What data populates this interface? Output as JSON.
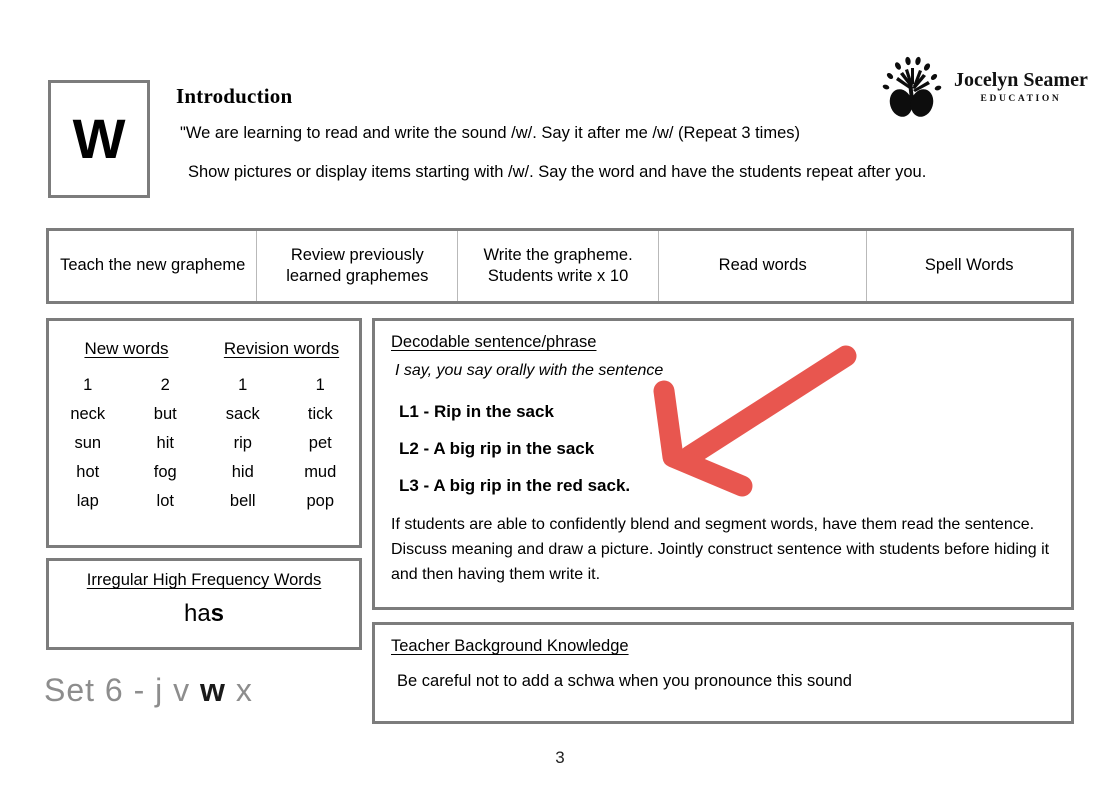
{
  "header": {
    "grapheme_letter": "W",
    "intro_title": "Introduction",
    "intro_line_1": "\"We are learning to read and write the sound /w/.  Say it after me /w/ (Repeat 3 times)",
    "intro_line_2": "Show pictures or display items starting with /w/.  Say the word and have the students repeat after you."
  },
  "logo": {
    "name": "Jocelyn Seamer",
    "subtitle": "EDUCATION",
    "mark": "tree-icon"
  },
  "steps": [
    {
      "label": "Teach the new grapheme"
    },
    {
      "label": "Review previously learned graphemes"
    },
    {
      "label": "Write the grapheme. Students write x 10"
    },
    {
      "label": "Read words"
    },
    {
      "label": "Spell Words"
    }
  ],
  "words_panel": {
    "heading_new": "New words",
    "heading_revision": "Revision words",
    "new_columns": [
      {
        "number": "1",
        "words": [
          "neck",
          "sun",
          "hot",
          "lap"
        ]
      },
      {
        "number": "2",
        "words": [
          "but",
          "hit",
          "fog",
          "lot"
        ]
      }
    ],
    "revision_columns": [
      {
        "number": "1",
        "words": [
          "sack",
          "rip",
          "hid",
          "bell"
        ]
      },
      {
        "number": "1",
        "words": [
          "tick",
          "pet",
          "mud",
          "pop"
        ]
      }
    ]
  },
  "irregular_words": {
    "title": "Irregular High Frequency Words",
    "word_plain": "ha",
    "word_bold": "s"
  },
  "set_line": {
    "prefix": "Set 6 - ",
    "letters": [
      "j",
      "v",
      "w",
      "x"
    ],
    "focus_letter": "w",
    "text_plain_before": "Set 6 -  j  v  ",
    "text_focus": "w",
    "text_plain_after": "  x",
    "color": "#8d8d8d",
    "focus_color": "#1a1a1a"
  },
  "sentence_panel": {
    "title": "Decodable sentence/phrase",
    "say_line": "I say, you say orally with the sentence",
    "levels": [
      "L1 - Rip in the sack",
      "L2 - A big rip in the sack",
      "L3 - A big rip in the red sack."
    ],
    "note": "If students are able to confidently blend and segment words, have them read the sentence. Discuss meaning and draw a picture. Jointly construct sentence with students before hiding it and then having them write it."
  },
  "teacher_panel": {
    "title": "Teacher Background Knowledge",
    "text": "Be careful not to add a schwa when you pronounce this sound"
  },
  "annotation": {
    "name": "red-arrow",
    "color": "#e8564f"
  },
  "footer": {
    "page_number": "3"
  },
  "colors": {
    "border": "#7c7c7c",
    "divider": "#b9b9b9",
    "annotation_red": "#e8564f",
    "muted_text": "#8d8d8d"
  }
}
